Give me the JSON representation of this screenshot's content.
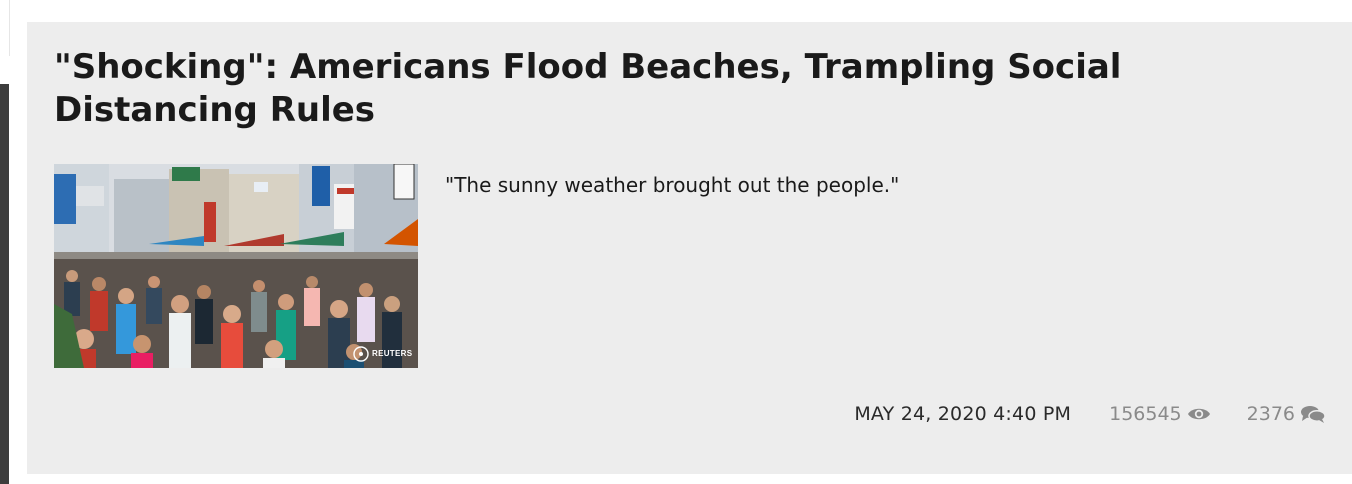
{
  "article": {
    "headline": "\"Shocking\": Americans Flood Beaches, Trampling Social Distancing Rules",
    "teaser": "\"The sunny weather brought out the people.\"",
    "image_credit": "REUTERS",
    "meta": {
      "date": "MAY 24, 2020 4:40 PM",
      "views": "156545",
      "comments": "2376",
      "views_icon": "eye-icon",
      "comments_icon": "comments-icon"
    }
  },
  "colors": {
    "card_background": "#ededed",
    "headline_text": "#1a1a1a",
    "meta_muted": "#8a8a8a",
    "left_rail": "#3d3d3d"
  }
}
